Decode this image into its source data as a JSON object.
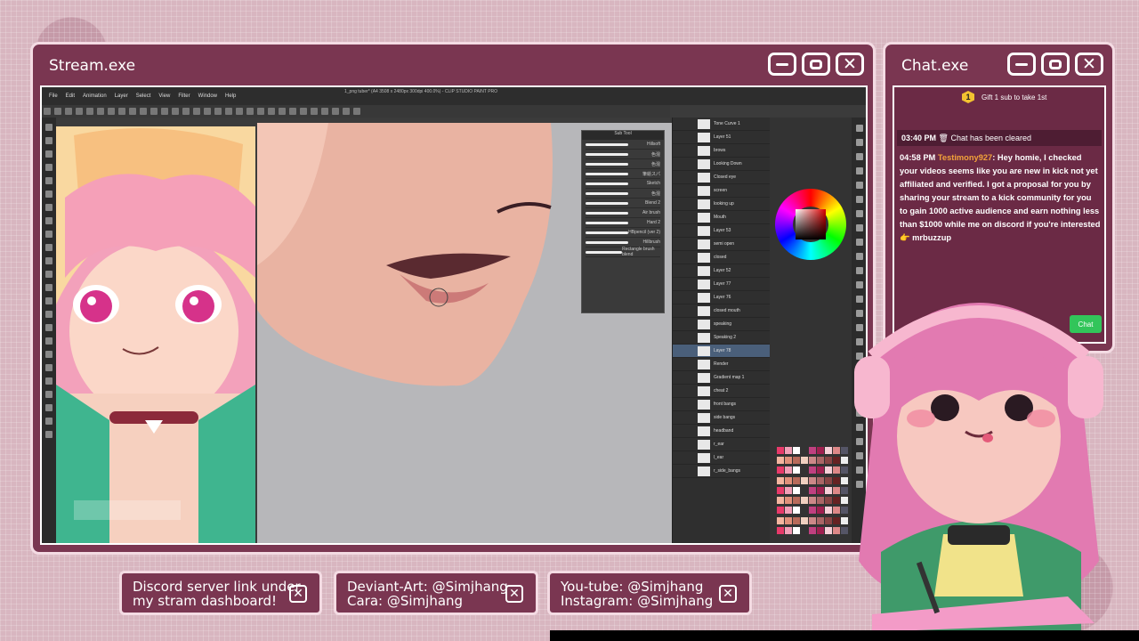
{
  "stream_window": {
    "title": "Stream.exe",
    "app": {
      "title": "1_png tuber* (A4 3508 x 2480px 300dpi 400.0%) - CLIP STUDIO PAINT PRO",
      "menu": [
        "File",
        "Edit",
        "Animation",
        "Layer",
        "Select",
        "View",
        "Filter",
        "Window",
        "Help"
      ],
      "subtool_brushes": [
        "Hillsoft",
        "色混",
        "色混",
        "筆絵スパ",
        "Sketch",
        "色混",
        "Blend 2",
        "Air brush",
        "Hard 2",
        "HBpencil (ver 2)",
        "Hillbrush",
        "Rectangle brush blend"
      ],
      "layers": [
        "Tone Curve 1",
        "Layer 51",
        "brows",
        "Looking Down",
        "Closed eye",
        "screen",
        "looking up",
        "Mouth",
        "Layer 53",
        "semi open",
        "closed",
        "Layer 52",
        "Layer 77",
        "Layer 76",
        "closed mouth",
        "speaking",
        "Speaking 2",
        "Layer 78",
        "Render",
        "Gradient map 1",
        "cheat 2",
        "front bangs",
        "side bangs",
        "headband",
        "r_ear",
        "l_ear",
        "r_side_bangs"
      ],
      "selected_layer_index": 17
    }
  },
  "chat_window": {
    "title": "Chat.exe",
    "gift_badge": "1",
    "gift_text": "Gift 1 sub to take 1st",
    "cleared": {
      "time": "03:40 PM",
      "text": "🗑 Chat has been cleared"
    },
    "message": {
      "time": "04:58 PM",
      "user": "Testimony927",
      "text": ": Hey homie, I checked your videos seems like you are new in kick not yet affiliated and verified. I got a proposal for you by sharing your stream to a kick community for you to gain 1000 active audience and earn nothing less than $1000 while me on discord if you're interested 👉 mrbuzzup"
    },
    "chat_button": "Chat"
  },
  "footer": [
    {
      "line1": "Discord server link under",
      "line2": "my stram dashboard!"
    },
    {
      "line1": "Deviant-Art: @Simjhang",
      "line2": "Cara: @Simjhang"
    },
    {
      "line1": "You-tube: @Simjhang",
      "line2": "Instagram: @Simjhang"
    }
  ],
  "colors": {
    "window_bg": "#7a3651",
    "window_border": "#f4dbe3",
    "chat_bg": "#6b2a45",
    "username": "#f2a23a",
    "chat_green": "#32c55a"
  },
  "icons": [
    "minimize-icon",
    "maximize-icon",
    "close-icon",
    "trash-icon",
    "point-right-emoji"
  ]
}
